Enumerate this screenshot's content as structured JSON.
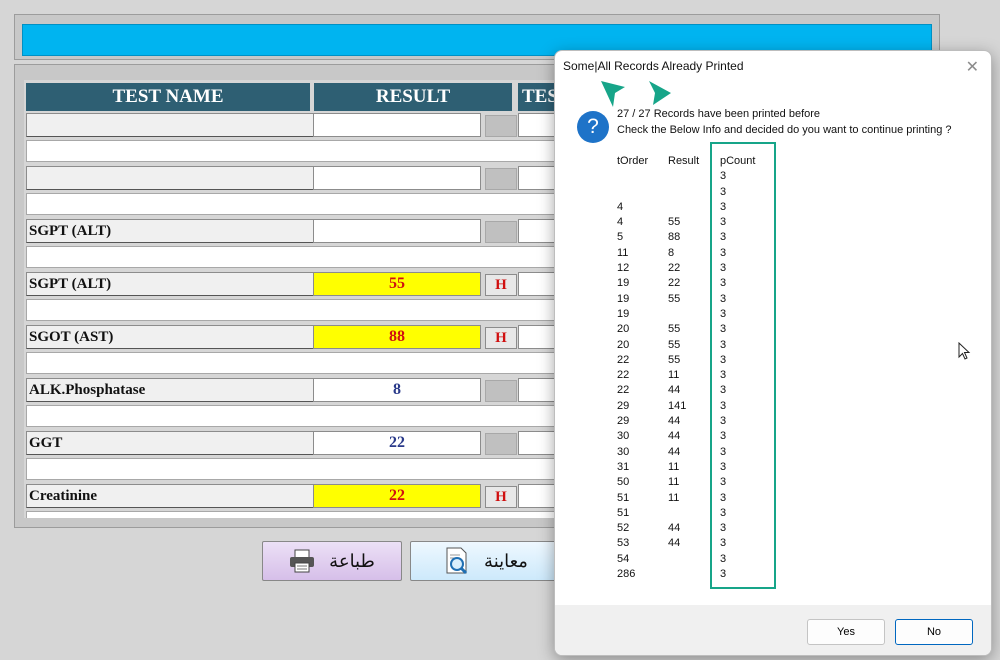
{
  "header": {
    "columns": [
      "TEST NAME",
      "RESULT",
      "TES"
    ]
  },
  "rows": [
    {
      "name": "",
      "result": "",
      "flag": "",
      "high": false
    },
    {
      "name": "",
      "result": "",
      "flag": "",
      "high": false
    },
    {
      "name": "SGPT (ALT)",
      "result": "",
      "flag": "",
      "high": false
    },
    {
      "name": "SGPT (ALT)",
      "result": "55",
      "flag": "H",
      "high": true
    },
    {
      "name": "SGOT (AST)",
      "result": "88",
      "flag": "H",
      "high": true
    },
    {
      "name": "ALK.Phosphatase",
      "result": "8",
      "flag": "",
      "high": false
    },
    {
      "name": "GGT",
      "result": "22",
      "flag": "",
      "high": false
    },
    {
      "name": "Creatinine",
      "result": "22",
      "flag": "H",
      "high": true
    }
  ],
  "buttons": {
    "print_label": "طباعة",
    "preview_label": "معاينة"
  },
  "dialog": {
    "title": "Some|All Records Already Printed",
    "close_glyph": "✕",
    "icon_glyph": "?",
    "line1": "27 / 27 Records have been printed before",
    "line2": "Check the Below Info and decided do you want to continue printing ?",
    "col_headers": {
      "order": "tOrder",
      "result": "Result",
      "count": "pCount"
    },
    "records": [
      {
        "tOrder": "",
        "result": "",
        "pCount": "3"
      },
      {
        "tOrder": "",
        "result": "",
        "pCount": "3"
      },
      {
        "tOrder": "4",
        "result": "",
        "pCount": "3"
      },
      {
        "tOrder": "4",
        "result": "55",
        "pCount": "3"
      },
      {
        "tOrder": "5",
        "result": "88",
        "pCount": "3"
      },
      {
        "tOrder": "11",
        "result": "8",
        "pCount": "3"
      },
      {
        "tOrder": "12",
        "result": "22",
        "pCount": "3"
      },
      {
        "tOrder": "19",
        "result": "22",
        "pCount": "3"
      },
      {
        "tOrder": "19",
        "result": "55",
        "pCount": "3"
      },
      {
        "tOrder": "19",
        "result": "",
        "pCount": "3"
      },
      {
        "tOrder": "20",
        "result": "55",
        "pCount": "3"
      },
      {
        "tOrder": "20",
        "result": "55",
        "pCount": "3"
      },
      {
        "tOrder": "22",
        "result": "55",
        "pCount": "3"
      },
      {
        "tOrder": "22",
        "result": "11",
        "pCount": "3"
      },
      {
        "tOrder": "22",
        "result": "44",
        "pCount": "3"
      },
      {
        "tOrder": "29",
        "result": "141",
        "pCount": "3"
      },
      {
        "tOrder": "29",
        "result": "44",
        "pCount": "3"
      },
      {
        "tOrder": "30",
        "result": "44",
        "pCount": "3"
      },
      {
        "tOrder": "30",
        "result": "44",
        "pCount": "3"
      },
      {
        "tOrder": "31",
        "result": "11",
        "pCount": "3"
      },
      {
        "tOrder": "50",
        "result": "11",
        "pCount": "3"
      },
      {
        "tOrder": "51",
        "result": "11",
        "pCount": "3"
      },
      {
        "tOrder": "51",
        "result": "",
        "pCount": "3"
      },
      {
        "tOrder": "52",
        "result": "44",
        "pCount": "3"
      },
      {
        "tOrder": "53",
        "result": "44",
        "pCount": "3"
      },
      {
        "tOrder": "54",
        "result": "",
        "pCount": "3"
      },
      {
        "tOrder": "286",
        "result": "",
        "pCount": "3"
      }
    ],
    "yes_label": "Yes",
    "no_label": "No"
  },
  "colors": {
    "header_bg": "#2e5f73",
    "top_bar": "#00b4f0",
    "high_bg": "#ffff00",
    "high_text": "#d01010",
    "highlight_box": "#17a589"
  },
  "icons": {
    "print": "printer-icon",
    "preview": "magnifier-document-icon",
    "dialog": "question-icon"
  }
}
